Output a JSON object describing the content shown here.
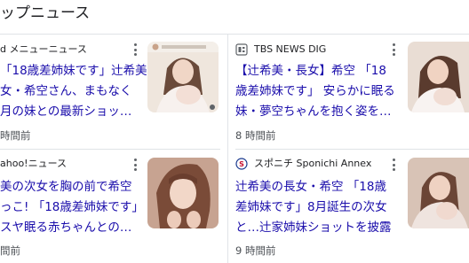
{
  "section": {
    "title": "ップニュース"
  },
  "cards": [
    {
      "source": "d メニューニュース",
      "headline_lines": [
        "「18歳差姉妹です」辻希美",
        "女・希空さん、まもなく",
        "月の妹との最新ショッ…"
      ],
      "time": "時間前",
      "icon": "menu-news-icon"
    },
    {
      "source": "TBS NEWS DIG",
      "headline_lines": [
        "【辻希美・長女】希空 「18",
        "歳差姉妹です」 安らかに眠る",
        "妹・夢空ちゃんを抱く姿を…"
      ],
      "time": "8 時間前",
      "icon": "tbs-news-dig-icon"
    },
    {
      "source": "ahoo!ニュース",
      "headline_lines": [
        "美の次女を胸の前で希空",
        "っこ! 「18歳差姉妹です」",
        "スヤ眠る赤ちゃんとの…"
      ],
      "time": "間前",
      "icon": "yahoo-news-icon"
    },
    {
      "source": "スポニチ Sponichi Annex",
      "headline_lines": [
        "辻希美の長女・希空 「18歳",
        "差姉妹です」8月誕生の次女",
        "と…辻家姉妹ショットを披露"
      ],
      "time": "9 時間前",
      "icon": "sponichi-annex-icon"
    }
  ],
  "colors": {
    "link": "#1a0dab",
    "meta": "#4d5156",
    "divider": "#e0e3e7"
  }
}
